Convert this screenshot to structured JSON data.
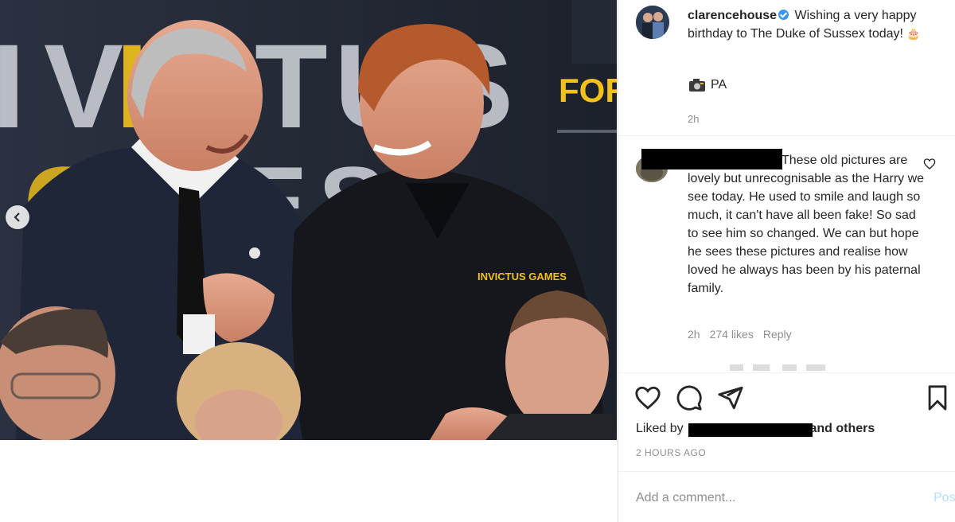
{
  "post": {
    "photo_banner_text": "INVICTUS GAMES",
    "photo_banner_side_text": "FOR",
    "jacket_logo": "INVICTUS GAMES"
  },
  "caption": {
    "username": "clarencehouse",
    "text": "Wishing a very happy birthday to The Duke of Sussex today!",
    "emoji": "🎂",
    "credit_icon": "camera-emoji",
    "credit": "PA",
    "time": "2h"
  },
  "comment": {
    "text": "These old pictures are lovely but unrecognisable as the Harry we see today. He used to smile and laugh so much, it can't have all been fake! So sad to see him so changed. We can but hope he sees these pictures and realise how loved he always has been by his paternal family.",
    "time": "2h",
    "likes": "274 likes",
    "reply": "Reply"
  },
  "likes_line": {
    "prefix": "Liked by",
    "suffix": "and others"
  },
  "posted_time": "2 HOURS AGO",
  "comment_box": {
    "placeholder": "Add a comment...",
    "post_label": "Post"
  },
  "icons": [
    "chevron-left-icon",
    "heart-icon",
    "comment-icon",
    "share-icon",
    "bookmark-icon",
    "verified-icon",
    "camera-icon"
  ],
  "colors": {
    "verified": "#3897f0",
    "muted": "#8e8e8e",
    "post_disabled": "#b2dffc",
    "banner_yellow": "#f2c21b"
  }
}
